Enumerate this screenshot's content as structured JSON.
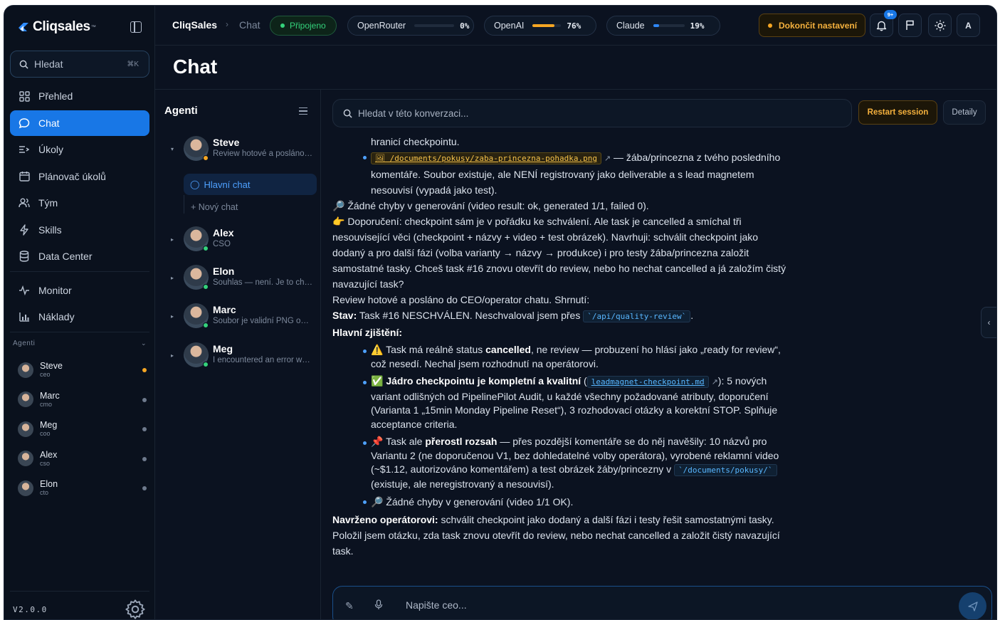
{
  "brand": {
    "name": "Cliqsales",
    "tm": "™"
  },
  "sidebar": {
    "search": {
      "label": "Hledat",
      "shortcut": "⌘K"
    },
    "nav": [
      {
        "label": "Přehled",
        "icon": "grid-icon",
        "active": false
      },
      {
        "label": "Chat",
        "icon": "chat-icon",
        "active": true
      },
      {
        "label": "Úkoly",
        "icon": "tasks-icon",
        "active": false
      },
      {
        "label": "Plánovač úkolů",
        "icon": "calendar-icon",
        "active": false
      },
      {
        "label": "Tým",
        "icon": "team-icon",
        "active": false
      },
      {
        "label": "Skills",
        "icon": "bolt-icon",
        "active": false
      },
      {
        "label": "Data Center",
        "icon": "database-icon",
        "active": false
      },
      {
        "label": "Monitor",
        "icon": "pulse-icon",
        "active": false
      },
      {
        "label": "Náklady",
        "icon": "bar-chart-icon",
        "active": false
      }
    ],
    "agents_title": "Agenti",
    "agents": [
      {
        "name": "Steve",
        "role": "ceo",
        "status": "active"
      },
      {
        "name": "Marc",
        "role": "cmo",
        "status": "idle"
      },
      {
        "name": "Meg",
        "role": "coo",
        "status": "idle"
      },
      {
        "name": "Alex",
        "role": "cso",
        "status": "idle"
      },
      {
        "name": "Elon",
        "role": "cto",
        "status": "idle"
      }
    ],
    "version": "V2.0.0"
  },
  "topbar": {
    "app": "CliqSales",
    "separator": "›",
    "page": "Chat",
    "connection": "Připojeno",
    "meters": [
      {
        "name": "OpenRouter",
        "percent": 0,
        "label": "0%",
        "color": "#2e7bd6"
      },
      {
        "name": "OpenAI",
        "percent": 76,
        "label": "76%",
        "color": "#f5a623"
      },
      {
        "name": "Claude",
        "percent": 19,
        "label": "19%",
        "color": "#2e86f5"
      }
    ],
    "finish_setup": "Dokončit nastavení",
    "notifications_badge": "9+",
    "avatar_initial": "A"
  },
  "page": {
    "title": "Chat"
  },
  "agents_panel": {
    "title": "Agenti",
    "agents": [
      {
        "name": "Steve",
        "subtitle": "Review hotové a posláno do CEO",
        "expanded": true
      },
      {
        "name": "Alex",
        "subtitle": "CSO"
      },
      {
        "name": "Elon",
        "subtitle": "Souhlas — není. Je to checkpoint"
      },
      {
        "name": "Marc",
        "subtitle": "Soubor je validní PNG obrázek"
      },
      {
        "name": "Meg",
        "subtitle": "I encountered an error while"
      }
    ],
    "main_chat": "Hlavní chat",
    "new_chat": "+ Nový chat"
  },
  "conversation": {
    "search_placeholder": "Hledat v této konverzaci...",
    "restart": "Restart session",
    "details": "Detaily",
    "composer_placeholder": "Napište ceo...",
    "lines": {
      "l1": "hranicí checkpointu.",
      "l2_code": "🖼 /documents/pokusy/zaba-princezna-pohadka.png",
      "l2_ext": "↗",
      "l2_rest": " — žába/princezna z tvého posledního",
      "l3": "komentáře. Soubor existuje, ale NENÍ registrovaný jako deliverable a s lead magnetem",
      "l4": "nesouvisí (vypadá jako test).",
      "l5": "🔎 Žádné chyby v generování (video result: ok, generated 1/1, failed 0).",
      "l6": "👉 Doporučení: checkpoint sám je v pořádku ke schválení. Ale task je cancelled a smíchal tři",
      "l7": "nesouvisející věci (checkpoint + názvy + video + test obrázek). Navrhuji: schválit checkpoint jako",
      "l8": "dodaný a pro další fázi (volba varianty → názvy → produkce) i pro testy žába/princezna založit",
      "l9": "samostatné tasky. Chceš task #16 znovu otevřít do review, nebo ho nechat cancelled a já založím čistý",
      "l10": "navazující task?",
      "l11": "Review hotové a posláno do CEO/operator chatu. Shrnutí:",
      "l12_b": "Stav:",
      "l12_t": " Task #16 NESCHVÁLEN. Neschvaloval jsem přes ",
      "l12_code": "`/api/quality-review`",
      "l12_end": ".",
      "l13_b": "Hlavní zjištění:",
      "b1_a": "⚠️ Task má reálně status ",
      "b1_b": "cancelled",
      "b1_c": ", ne review — probuzení ho hlásí jako „ready for review“,",
      "b1_d": "což nesedí. Nechal jsem rozhodnutí na operátorovi.",
      "b2_b": "✅ Jádro checkpointu je kompletní a kvalitní",
      "b2_open": " (",
      "b2_code": "leadmagnet-checkpoint.md",
      "b2_ext": "↗",
      "b2_rest": "): 5 nových",
      "b2_d": "variant odlišných od PipelinePilot Audit, u každé všechny požadované atributy, doporučení",
      "b2_e": "(Varianta 1 „15min Monday Pipeline Reset“), 3 rozhodovací otázky a korektní STOP. Splňuje",
      "b2_f": "acceptance criteria.",
      "b3_a": "📌 Task ale ",
      "b3_b": "přerostl rozsah",
      "b3_c": " — přes pozdější komentáře se do něj navěšily: 10 názvů pro",
      "b3_d": "Variantu 2 (ne doporučenou V1, bez dohledatelné volby operátora), vyrobené reklamní video",
      "b3_e": "(~$1.12, autorizováno komentářem) a test obrázek žáby/princezny v ",
      "b3_code": "`/documents/pokusy/`",
      "b3_f": "(existuje, ale neregistrovaný a nesouvisí).",
      "b4": "🔎 Žádné chyby v generování (video 1/1 OK).",
      "l14_b": "Navrženo operátorovi:",
      "l14_t": " schválit checkpoint jako dodaný a další fázi i testy řešit samostatnými tasky.",
      "l15": "Položil jsem otázku, zda task znovu otevřít do review, nebo nechat cancelled a založit čistý navazující",
      "l16": "task."
    }
  }
}
